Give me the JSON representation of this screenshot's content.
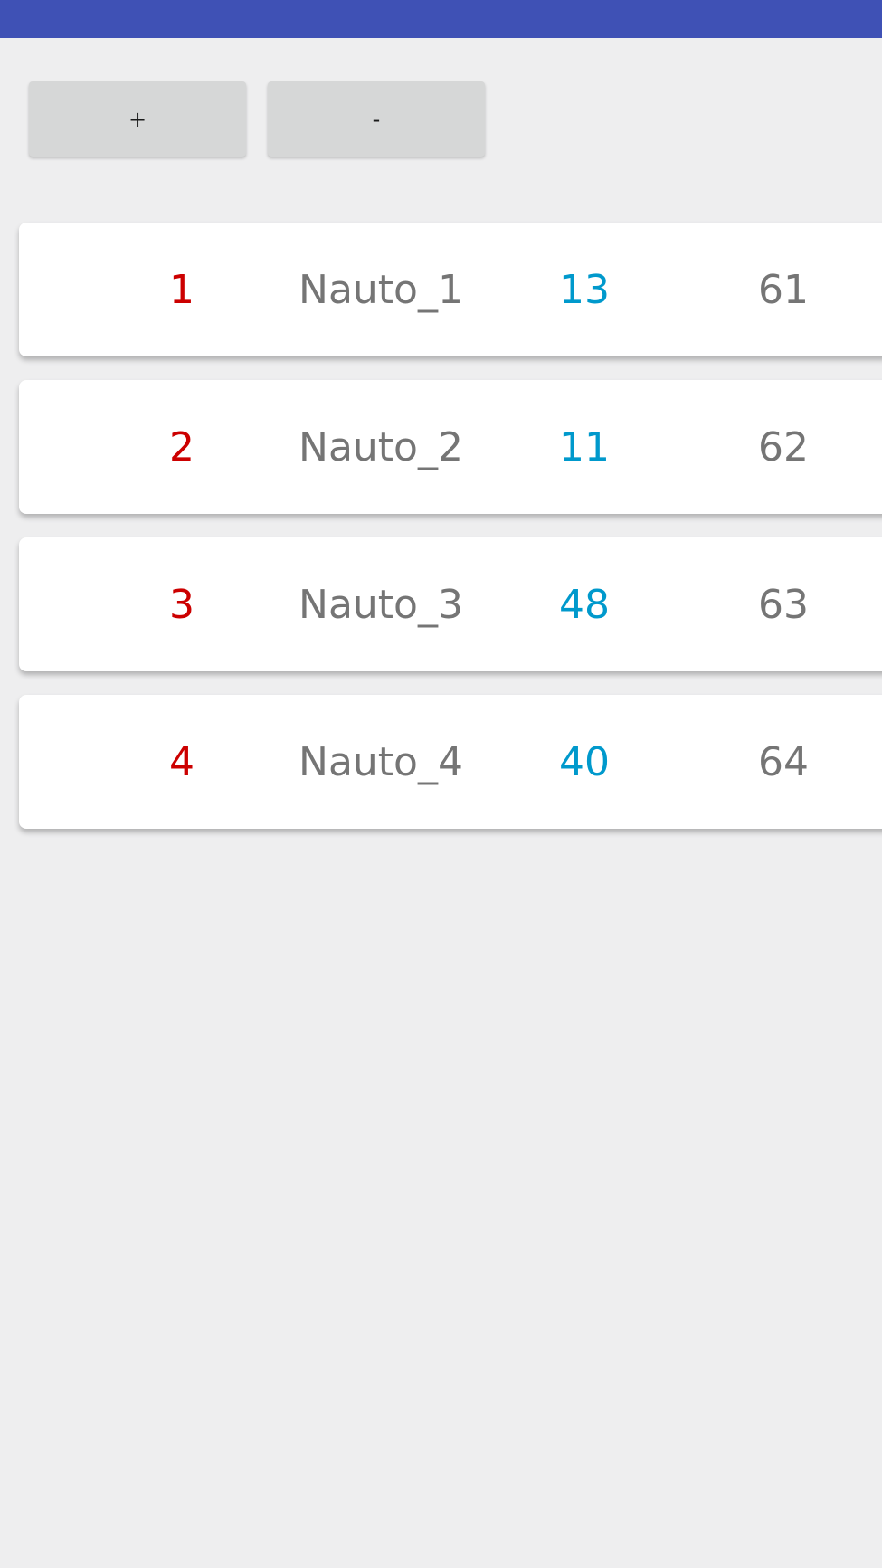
{
  "colors": {
    "app_bar": "#3f51b5",
    "background": "#eeeeef",
    "button": "#d6d7d7",
    "index_text": "#cc0000",
    "value_text": "#0099cc",
    "secondary_text": "#757575"
  },
  "controls": {
    "plus_label": "+",
    "minus_label": "-"
  },
  "rows": [
    {
      "index": "1",
      "name": "Nauto_1",
      "value": "13",
      "number": "61"
    },
    {
      "index": "2",
      "name": "Nauto_2",
      "value": "11",
      "number": "62"
    },
    {
      "index": "3",
      "name": "Nauto_3",
      "value": "48",
      "number": "63"
    },
    {
      "index": "4",
      "name": "Nauto_4",
      "value": "40",
      "number": "64"
    }
  ]
}
